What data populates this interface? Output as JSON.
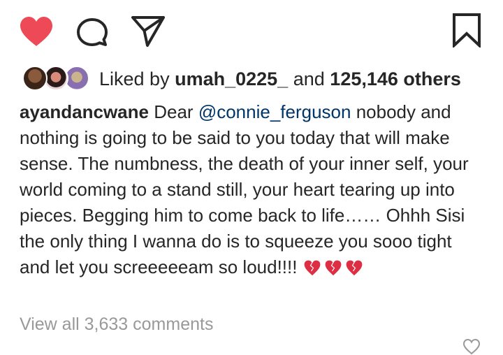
{
  "actions": {
    "like_icon": "filled-heart-icon",
    "comment_icon": "comment-bubble-icon",
    "share_icon": "paper-plane-icon",
    "save_icon": "bookmark-icon",
    "like_color": "#ed4956"
  },
  "likes": {
    "prefix": "Liked by",
    "user": "umah_0225_",
    "conjunction": "and",
    "others": "125,146 others"
  },
  "caption": {
    "username": "ayandancwane",
    "lead": "Dear",
    "mention": "@connie_ferguson",
    "body": " nobody and nothing is going to be said to you today that will make sense. The numbness, the death of your inner self, your world coming to a stand still, your heart tearing up into pieces. Begging him to come back to life…… Ohhh Sisi the only thing I wanna do is to squeeze you sooo tight and let you screeeeeam so loud!!!!",
    "emoji": "broken-heart-icon"
  },
  "comments": {
    "view_all": "View all 3,633 comments"
  }
}
